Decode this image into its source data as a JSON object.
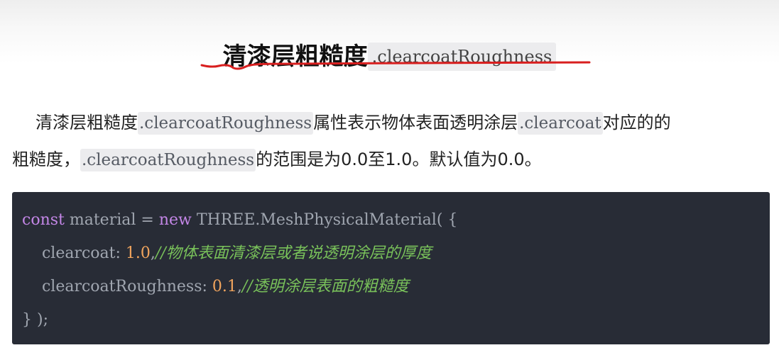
{
  "heading": {
    "text": "清漆层粗糙度",
    "code": ".clearcoatRoughness"
  },
  "paragraph": {
    "line1": {
      "t1": "清漆层粗糙度",
      "c1": ".clearcoatRoughness",
      "t2": "属性表示物体表面透明涂层",
      "c2": ".clearcoat",
      "t3": "对应的的"
    },
    "line2": {
      "t1": "粗糙度，",
      "c1": ".clearcoatRoughness",
      "t2": "的范围是为0.0至1.0。默认值为0.0。"
    }
  },
  "code": {
    "line1": {
      "kw1": "const",
      "p1": " material = ",
      "kw2": "new",
      "p2": " THREE.MeshPhysicalMaterial( {"
    },
    "line2": {
      "p1": "    clearcoat: ",
      "num": "1.0",
      "p2": ",",
      "cmt": "//物体表面清漆层或者说透明涂层的厚度"
    },
    "line3": {
      "p1": "    clearcoatRoughness: ",
      "num": "0.1",
      "p2": ",",
      "cmt": "//透明涂层表面的粗糙度"
    },
    "line4": {
      "p1": "} );"
    }
  },
  "colors": {
    "code_background": "#282c36",
    "keyword": "#c386e6",
    "number": "#f0a45d",
    "comment": "#79c25a",
    "annotation_underline": "#d81e1e"
  }
}
